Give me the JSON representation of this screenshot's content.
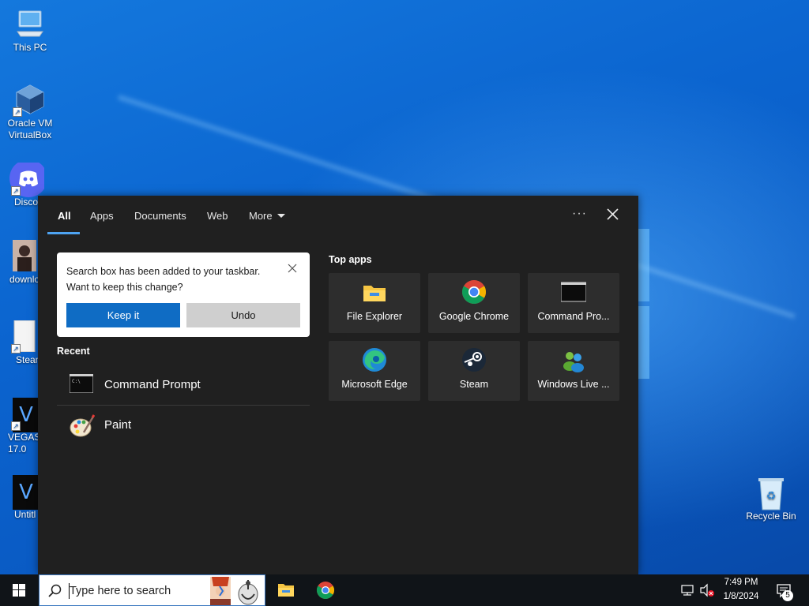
{
  "desktop": {
    "icons": [
      {
        "label": "This PC"
      },
      {
        "label": "Oracle VM VirtualBox"
      },
      {
        "label": "Disco"
      },
      {
        "label": "downlo"
      },
      {
        "label": "Stean"
      },
      {
        "label": "VEGAS 17.0"
      },
      {
        "label": "Untitl"
      },
      {
        "label": "Recycle Bin"
      }
    ]
  },
  "search_panel": {
    "tabs": [
      {
        "label": "All"
      },
      {
        "label": "Apps"
      },
      {
        "label": "Documents"
      },
      {
        "label": "Web"
      },
      {
        "label": "More"
      }
    ],
    "ellipsis": "···",
    "toast": {
      "line1": "Search box has been added to your taskbar.",
      "line2": "Want to keep this change?",
      "keep_label": "Keep it",
      "undo_label": "Undo"
    },
    "recent_title": "Recent",
    "recent": [
      {
        "label": "Command Prompt",
        "icon": "command-prompt-icon"
      },
      {
        "label": "Paint",
        "icon": "paint-icon"
      }
    ],
    "top_apps_title": "Top apps",
    "top_apps": [
      {
        "label": "File Explorer",
        "icon": "file-explorer-icon"
      },
      {
        "label": "Google Chrome",
        "icon": "chrome-icon"
      },
      {
        "label": "Command Pro...",
        "icon": "command-prompt-icon"
      },
      {
        "label": "Microsoft Edge",
        "icon": "edge-icon"
      },
      {
        "label": "Steam",
        "icon": "steam-icon"
      },
      {
        "label": "Windows Live ...",
        "icon": "windows-live-icon"
      }
    ]
  },
  "taskbar": {
    "search_placeholder": "Type here to search",
    "time": "7:49 PM",
    "date": "1/8/2024",
    "notification_count": "5"
  },
  "colors": {
    "accent": "#0f6cc4",
    "panel_bg": "#202020",
    "tile_bg": "#2d2d2d",
    "tab_underline": "#4ea3f1"
  }
}
